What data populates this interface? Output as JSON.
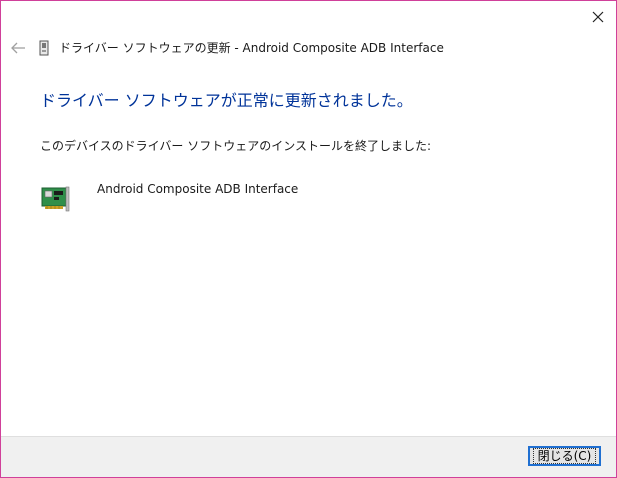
{
  "window": {
    "title": "ドライバー ソフトウェアの更新 - Android Composite ADB Interface",
    "close_icon": "close-icon",
    "back_icon": "back-arrow-icon"
  },
  "main": {
    "heading": "ドライバー ソフトウェアが正常に更新されました。",
    "description": "このデバイスのドライバー ソフトウェアのインストールを終了しました:",
    "device": {
      "icon": "network-card-icon",
      "name": "Android Composite ADB Interface"
    }
  },
  "footer": {
    "close_label": "閉じる(C)"
  },
  "colors": {
    "heading": "#003399",
    "border": "#d0409a",
    "focus": "#1f6fd1",
    "footer_bg": "#f0f0f0"
  }
}
